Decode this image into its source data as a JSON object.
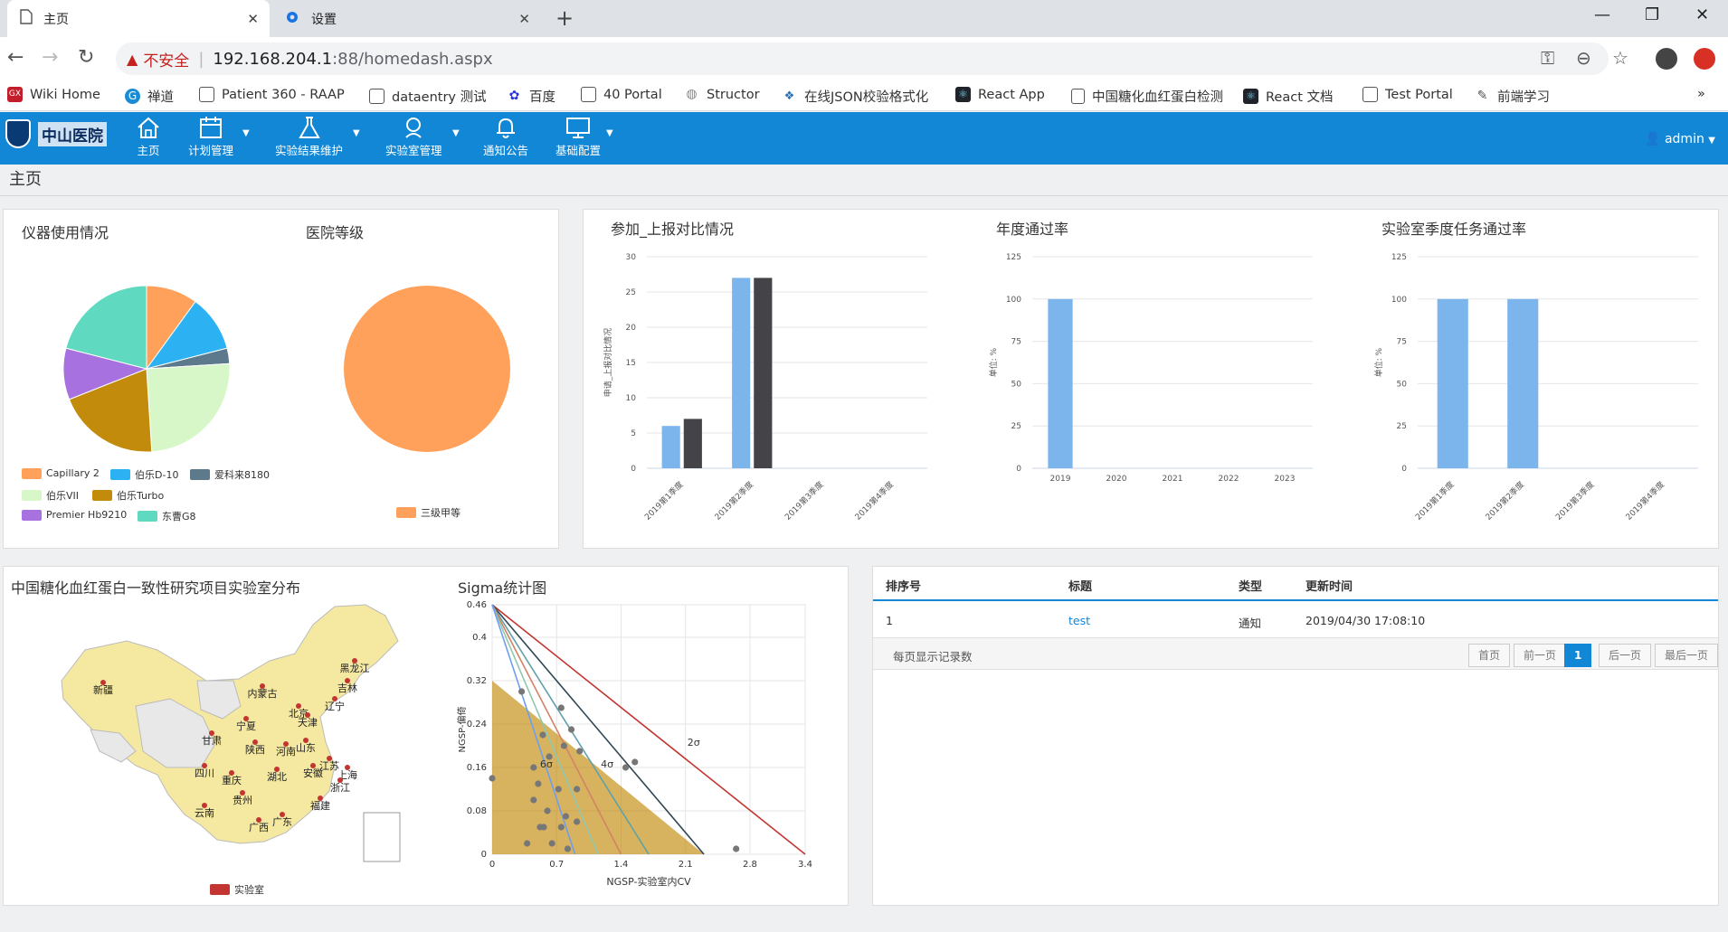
{
  "browser": {
    "tabs": [
      {
        "label": "主页",
        "active": true
      },
      {
        "label": "设置",
        "active": false
      }
    ],
    "address": {
      "warning": "不安全",
      "host": "192.168.204.1",
      "path": ":88/homedash.aspx"
    },
    "bookmarks": [
      "Wiki Home",
      "禅道",
      "Patient 360 - RAAP",
      "dataentry 测试",
      "百度",
      "40 Portal",
      "Structor",
      "在线JSON校验格式化",
      "React App",
      "中国糖化血红蛋白检测",
      "React 文档",
      "Test Portal",
      "前端学习"
    ],
    "bookmarks_more": "»"
  },
  "app": {
    "logo_text": "中山医院",
    "nav": [
      {
        "label": "主页",
        "icon": "home-icon",
        "dropdown": false
      },
      {
        "label": "计划管理",
        "icon": "calendar-icon",
        "dropdown": true
      },
      {
        "label": "实验结果维护",
        "icon": "flask-icon",
        "dropdown": true
      },
      {
        "label": "实验室管理",
        "icon": "lab-icon",
        "dropdown": true
      },
      {
        "label": "通知公告",
        "icon": "bell-icon",
        "dropdown": false
      },
      {
        "label": "基础配置",
        "icon": "monitor-icon",
        "dropdown": true
      }
    ],
    "user": "admin",
    "breadcrumb": "主页"
  },
  "colors": {
    "accent": "#1187d6",
    "bar_blue": "#7cb5ec",
    "bar_dark": "#434348",
    "map_fill": "#f5e8a0",
    "map_grey": "#e8e8e8",
    "lab_dot": "#c23531"
  },
  "panels": {
    "instrument_title": "仪器使用情况",
    "grade_title": "医院等级",
    "report_title": "参加_上报对比情况",
    "annual_title": "年度通过率",
    "quarter_title": "实验室季度任务通过率",
    "map_title": "中国糖化血红蛋白一致性研究项目实验室分布",
    "sigma_title": "Sigma统计图"
  },
  "chart_data": [
    {
      "type": "pie",
      "title": "仪器使用情况",
      "labels": [
        "Capillary 2",
        "伯乐D-10",
        "爱科来8180",
        "伯乐VII",
        "伯乐Turbo",
        "Premier Hb9210",
        "东曹G8"
      ],
      "values": [
        10,
        11,
        3,
        25,
        20,
        10,
        21
      ],
      "colors": [
        "#ffa15a",
        "#2cb2f2",
        "#5c7a8c",
        "#d8f7c8",
        "#c28b0b",
        "#a771e0",
        "#5fd9c0"
      ]
    },
    {
      "type": "pie",
      "title": "医院等级",
      "labels": [
        "三级甲等"
      ],
      "values": [
        1
      ],
      "colors": [
        "#ffa15a"
      ]
    },
    {
      "type": "bar",
      "title": "参加_上报对比情况",
      "ylabel": "申请_上报对比情况",
      "categories": [
        "2019第1季度",
        "2019第2季度",
        "2019第3季度",
        "2019第4季度"
      ],
      "series": [
        {
          "values": [
            6,
            27,
            0,
            0
          ]
        },
        {
          "values": [
            7,
            27,
            0,
            0
          ]
        }
      ],
      "ylim": [
        0,
        30
      ],
      "yticks": [
        0,
        5,
        10,
        15,
        20,
        25,
        30
      ]
    },
    {
      "type": "bar",
      "title": "年度通过率",
      "ylabel": "单位: %",
      "categories": [
        "2019",
        "2020",
        "2021",
        "2022",
        "2023"
      ],
      "series": [
        {
          "values": [
            100,
            0,
            0,
            0,
            0
          ]
        }
      ],
      "ylim": [
        0,
        125
      ],
      "yticks": [
        0,
        25,
        50,
        75,
        100,
        125
      ]
    },
    {
      "type": "bar",
      "title": "实验室季度任务通过率",
      "ylabel": "单位: %",
      "categories": [
        "2019第1季度",
        "2019第2季度",
        "2019第3季度",
        "2019第4季度"
      ],
      "series": [
        {
          "values": [
            100,
            100,
            0,
            0
          ]
        }
      ],
      "ylim": [
        0,
        125
      ],
      "yticks": [
        0,
        25,
        50,
        75,
        100,
        125
      ]
    },
    {
      "type": "scatter",
      "title": "Sigma统计图",
      "xlabel": "NGSP-实验室内CV",
      "ylabel": "NGSP-偏倚",
      "xlim": [
        0,
        3.4
      ],
      "ylim": [
        0,
        0.46
      ],
      "xticks": [
        0,
        0.7,
        1.4,
        2.1,
        2.8,
        3.4
      ],
      "yticks": [
        0,
        0.08,
        0.16,
        0.24,
        0.32,
        0.4,
        0.46
      ],
      "sigma_labels": [
        {
          "text": "2σ",
          "x": 2.12,
          "y": 0.2
        },
        {
          "text": "4σ",
          "x": 1.18,
          "y": 0.16
        },
        {
          "text": "6σ",
          "x": 0.52,
          "y": 0.16
        }
      ],
      "lines": [
        {
          "x_end": 3.4,
          "color": "#c23531"
        },
        {
          "x_end": 2.3,
          "color": "#2f4554"
        },
        {
          "x_end": 1.7,
          "color": "#61a0a8"
        },
        {
          "x_end": 1.4,
          "color": "#d48265"
        },
        {
          "x_end": 1.15,
          "color": "#91c7ae"
        },
        {
          "x_end": 0.9,
          "color": "#6e9ef1"
        }
      ],
      "points": [
        [
          0.32,
          0.3
        ],
        [
          0.75,
          0.27
        ],
        [
          0.55,
          0.22
        ],
        [
          0.86,
          0.23
        ],
        [
          0.62,
          0.18
        ],
        [
          0.78,
          0.2
        ],
        [
          0.95,
          0.19
        ],
        [
          1.55,
          0.17
        ],
        [
          1.45,
          0.16
        ],
        [
          0.45,
          0.16
        ],
        [
          0.5,
          0.13
        ],
        [
          0.72,
          0.12
        ],
        [
          0.92,
          0.12
        ],
        [
          0.45,
          0.1
        ],
        [
          0.6,
          0.08
        ],
        [
          0.0,
          0.14
        ],
        [
          0.8,
          0.07
        ],
        [
          0.92,
          0.06
        ],
        [
          0.52,
          0.05
        ],
        [
          0.56,
          0.05
        ],
        [
          0.75,
          0.05
        ],
        [
          0.38,
          0.02
        ],
        [
          0.65,
          0.02
        ],
        [
          0.82,
          0.01
        ],
        [
          2.65,
          0.01
        ]
      ]
    }
  ],
  "map": {
    "legend": "实验室",
    "provinces": [
      "新疆",
      "内蒙古",
      "黑龙江",
      "吉林",
      "辽宁",
      "北京",
      "天津",
      "宁夏",
      "甘肃",
      "山东",
      "陕西",
      "河南",
      "四川",
      "重庆",
      "湖北",
      "安徽",
      "江苏",
      "上海",
      "浙江",
      "贵州",
      "云南",
      "广西",
      "广东",
      "福建"
    ]
  },
  "table": {
    "columns": [
      "排序号",
      "标题",
      "类型",
      "更新时间"
    ],
    "rows": [
      {
        "order": "1",
        "title": "test",
        "type": "通知",
        "updated": "2019/04/30 17:08:10"
      }
    ],
    "footer": {
      "rows_per_page": "每页显示记录数",
      "pages": [
        "首页",
        "前一页",
        "1",
        "后一页",
        "最后一页"
      ]
    }
  }
}
